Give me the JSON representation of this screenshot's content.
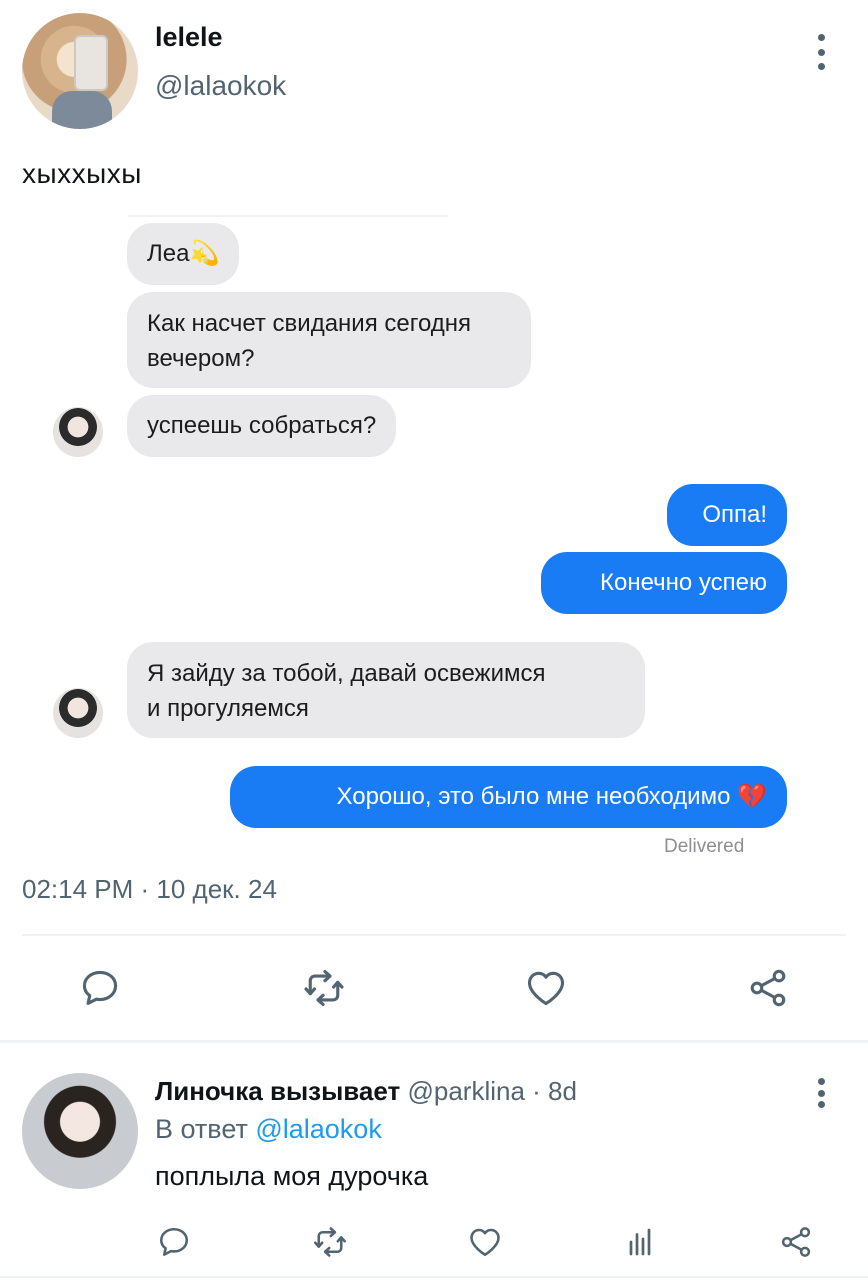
{
  "tweet": {
    "display_name": "lelele",
    "handle": "@lalaokok",
    "text": "хыххыхы",
    "timestamp": "02:14 PM · 10 дек. 24"
  },
  "chat": {
    "messages": [
      {
        "from": "them",
        "text": "Леа💫"
      },
      {
        "from": "them",
        "line1": "Как насчет свидания сегодня",
        "line2": "вечером?"
      },
      {
        "from": "them",
        "text": "успеешь собраться?"
      },
      {
        "from": "me",
        "text": "Оппа!"
      },
      {
        "from": "me",
        "text": "Конечно успею"
      },
      {
        "from": "them",
        "line1": "Я зайду за тобой, давай освежимся",
        "line2": "и прогуляемся"
      },
      {
        "from": "me",
        "text": "Хорошо, это было мне необходимо 💔"
      }
    ],
    "status": "Delivered"
  },
  "actions": [
    "reply-icon",
    "retweet-icon",
    "like-icon",
    "share-icon"
  ],
  "reply": {
    "display_name": "Линочка вызывает",
    "handle": "@parklina",
    "age": "· 8d",
    "in_reply_prefix": "В ответ",
    "in_reply_mention": "@lalaokok",
    "text": "поплыла моя дурочка",
    "actions": [
      "reply-icon",
      "retweet-icon",
      "like-icon",
      "views-icon",
      "share-icon"
    ]
  },
  "colors": {
    "accent": "#1d9bf0",
    "outgoing_bubble": "#1a7cf5",
    "incoming_bubble": "#e9e9eb",
    "secondary_text": "#536471"
  }
}
